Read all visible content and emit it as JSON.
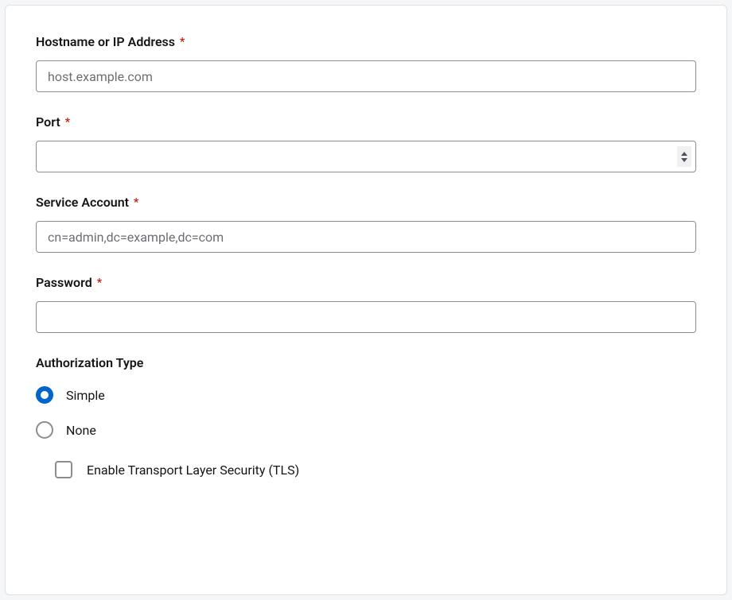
{
  "fields": {
    "hostname": {
      "label": "Hostname or IP Address",
      "required": true,
      "placeholder": "host.example.com",
      "value": ""
    },
    "port": {
      "label": "Port",
      "required": true,
      "value": ""
    },
    "serviceAccount": {
      "label": "Service Account",
      "required": true,
      "placeholder": "cn=admin,dc=example,dc=com",
      "value": ""
    },
    "password": {
      "label": "Password",
      "required": true,
      "value": ""
    }
  },
  "requiredMark": "*",
  "authType": {
    "heading": "Authorization Type",
    "options": {
      "simple": {
        "label": "Simple",
        "selected": true
      },
      "none": {
        "label": "None",
        "selected": false
      }
    }
  },
  "tls": {
    "label": "Enable Transport Layer Security (TLS)",
    "checked": false
  }
}
